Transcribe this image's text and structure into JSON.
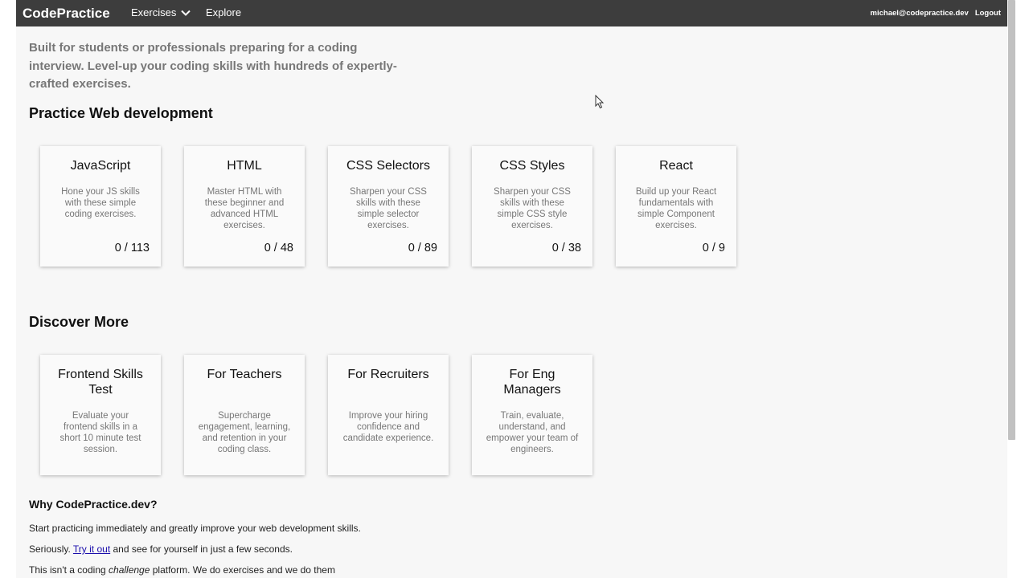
{
  "navbar": {
    "brand": "CodePractice",
    "exercises_label": "Exercises",
    "explore_label": "Explore",
    "user_email": "michael@codepractice.dev",
    "logout_label": "Logout"
  },
  "intro": "Built for students or professionals preparing for a coding interview. Level-up your coding skills with hundreds of expertly-crafted exercises.",
  "practice": {
    "title": "Practice Web development",
    "cards": [
      {
        "title": "JavaScript",
        "desc": "Hone your JS skills with these simple coding exercises.",
        "count": "0 / 113"
      },
      {
        "title": "HTML",
        "desc": "Master HTML with these beginner and advanced HTML exercises.",
        "count": "0 / 48"
      },
      {
        "title": "CSS Selectors",
        "desc": "Sharpen your CSS skills with these simple selector exercises.",
        "count": "0 / 89"
      },
      {
        "title": "CSS Styles",
        "desc": "Sharpen your CSS skills with these simple CSS style exercises.",
        "count": "0 / 38"
      },
      {
        "title": "React",
        "desc": "Build up your React fundamentals with simple Component exercises.",
        "count": "0 / 9"
      }
    ]
  },
  "discover": {
    "title": "Discover More",
    "cards": [
      {
        "title": "Frontend Skills Test",
        "desc": "Evaluate your frontend skills in a short 10 minute test session."
      },
      {
        "title": "For Teachers",
        "desc": "Supercharge engagement, learning, and retention in your coding class."
      },
      {
        "title": "For Recruiters",
        "desc": "Improve your hiring confidence and candidate experience."
      },
      {
        "title": "For Eng Managers",
        "desc": "Train, evaluate, understand, and empower your team of engineers."
      }
    ]
  },
  "why": {
    "title": "Why CodePractice.dev?",
    "p1": "Start practicing immediately and greatly improve your web development skills.",
    "p2_before": "Seriously.",
    "p2_link": "Try it out",
    "p2_after": "and see for yourself in just a few seconds.",
    "p3_before": "This isn't a coding",
    "p3_em": "challenge",
    "p3_after": "platform. We do exercises and we do them"
  },
  "icons": {
    "exercises_dropdown": "chevron-down-icon",
    "cursor": "mouse-pointer-icon"
  }
}
